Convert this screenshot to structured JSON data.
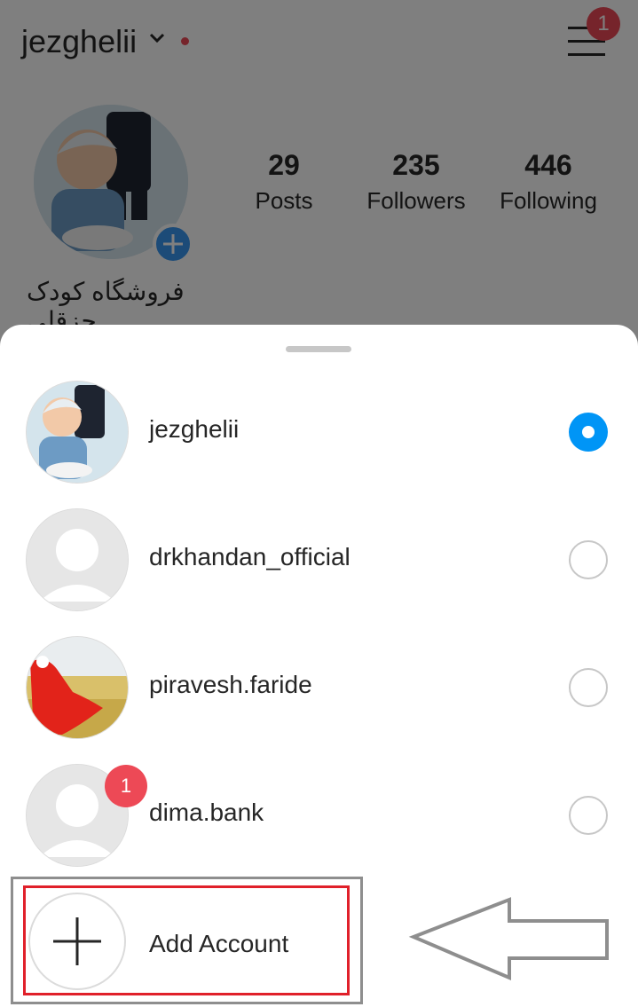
{
  "profile": {
    "username": "jezghelii",
    "menu_badge": "1",
    "bio": "فروشگاه کودک جزقلی",
    "stats": [
      {
        "value": "29",
        "label": "Posts"
      },
      {
        "value": "235",
        "label": "Followers"
      },
      {
        "value": "446",
        "label": "Following"
      }
    ]
  },
  "accounts": [
    {
      "username": "jezghelii",
      "selected": true,
      "badge": ""
    },
    {
      "username": "drkhandan_official",
      "selected": false,
      "badge": ""
    },
    {
      "username": "piravesh.faride",
      "selected": false,
      "badge": ""
    },
    {
      "username": "dima.bank",
      "selected": false,
      "badge": "1"
    }
  ],
  "add_account_label": "Add Account",
  "colors": {
    "accent_blue": "#0095f6",
    "badge_red": "#ed4956",
    "highlight_red": "#e0202a",
    "highlight_gray": "#8e8e8e"
  }
}
